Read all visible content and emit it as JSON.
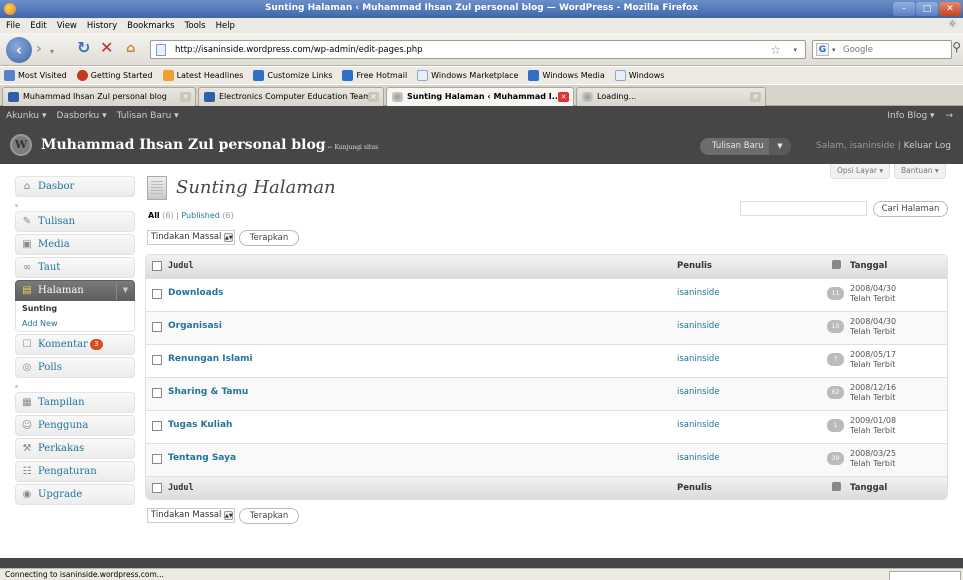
{
  "browser": {
    "window_title": "Sunting Halaman ‹ Muhammad Ihsan Zul personal blog — WordPress - Mozilla Firefox",
    "menu": [
      "File",
      "Edit",
      "View",
      "History",
      "Bookmarks",
      "Tools",
      "Help"
    ],
    "url": "http://isaninside.wordpress.com/wp-admin/edit-pages.php",
    "search_placeholder": "Google",
    "bookmarks": [
      "Most Visited",
      "Getting Started",
      "Latest Headlines",
      "Customize Links",
      "Free Hotmail",
      "Windows Marketplace",
      "Windows Media",
      "Windows"
    ],
    "tabs": [
      {
        "label": "Muhammad Ihsan Zul personal blog",
        "active": false
      },
      {
        "label": "Electronics Computer Education Team",
        "active": false
      },
      {
        "label": "Sunting Halaman ‹ Muhammad I...",
        "active": true
      },
      {
        "label": "Loading...",
        "active": false
      }
    ],
    "status": "Connecting to isaninside.wordpress.com..."
  },
  "wp": {
    "adminbar": {
      "items": [
        "Akunku ▾",
        "Dasborku ▾",
        "Tulisan Baru ▾"
      ],
      "right": "Info Blog ▾"
    },
    "site_title": "Muhammad Ihsan Zul personal blog",
    "visit_site": "← Kunjungi situs",
    "new_post": "Tulisan Baru",
    "greeting": "Salam, isaninside",
    "logout": "Keluar Log",
    "screen_options": "Opsi Layar ▾",
    "help": "Bantuan ▾",
    "sidebar": {
      "dashboard": "Dasbor",
      "posts": "Tulisan",
      "media": "Media",
      "links": "Taut",
      "pages": "Halaman",
      "pages_sub": [
        "Sunting",
        "Add New"
      ],
      "comments": "Komentar",
      "comments_count": "3",
      "polls": "Polls",
      "appearance": "Tampilan",
      "users": "Pengguna",
      "tools": "Perkakas",
      "settings": "Pengaturan",
      "upgrade": "Upgrade"
    },
    "page_title": "Sunting Halaman",
    "filter": {
      "all": "All",
      "all_count": "(6)",
      "published": "Published",
      "published_count": "(6)"
    },
    "search_button": "Cari Halaman",
    "bulk_action": "Tindakan Massal",
    "apply": "Terapkan",
    "columns": {
      "title": "Judul",
      "author": "Penulis",
      "date": "Tanggal"
    },
    "rows": [
      {
        "title": "Downloads",
        "author": "isaninside",
        "comments": "11",
        "date": "2008/04/30",
        "status": "Telah Terbit"
      },
      {
        "title": "Organisasi",
        "author": "isaninside",
        "comments": "10",
        "date": "2008/04/30",
        "status": "Telah Terbit"
      },
      {
        "title": "Renungan Islami",
        "author": "isaninside",
        "comments": "7",
        "date": "2008/05/17",
        "status": "Telah Terbit"
      },
      {
        "title": "Sharing & Tamu",
        "author": "isaninside",
        "comments": "62",
        "date": "2008/12/16",
        "status": "Telah Terbit"
      },
      {
        "title": "Tugas Kuliah",
        "author": "isaninside",
        "comments": "1",
        "date": "2009/01/08",
        "status": "Telah Terbit"
      },
      {
        "title": "Tentang Saya",
        "author": "isaninside",
        "comments": "39",
        "date": "2008/03/25",
        "status": "Telah Terbit"
      }
    ]
  }
}
